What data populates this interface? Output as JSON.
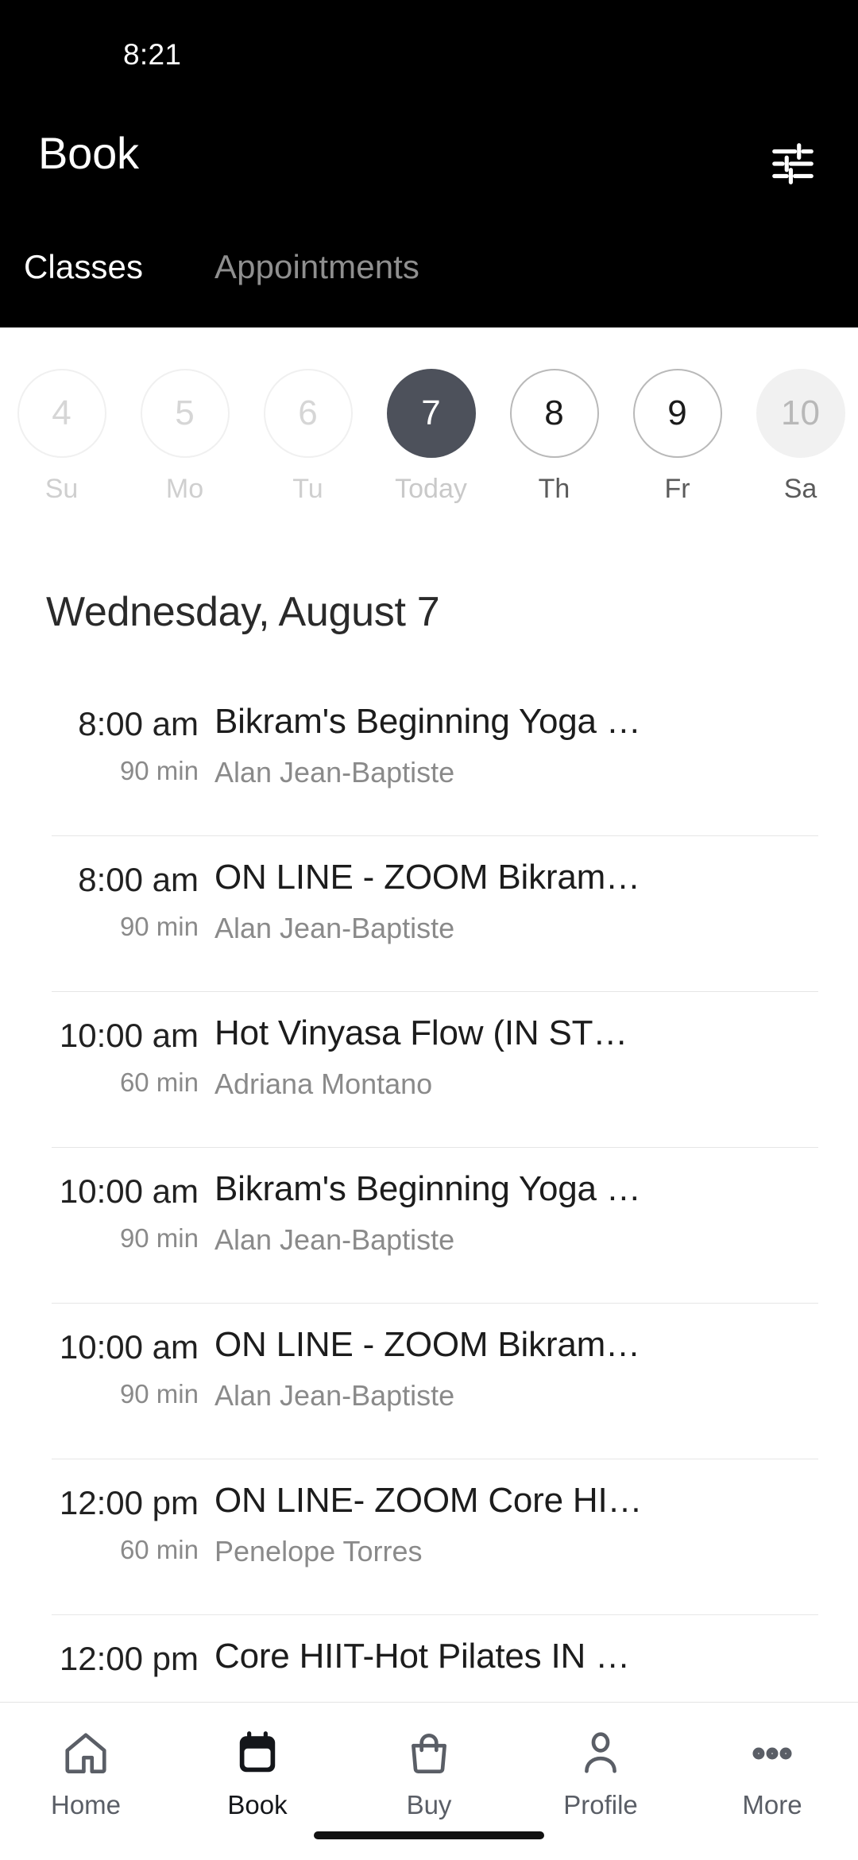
{
  "status_bar": {
    "time": "8:21"
  },
  "header": {
    "title": "Book",
    "filter_icon": "tune-sliders-icon",
    "background_color": "#000000",
    "tabs": [
      {
        "label": "Classes",
        "selected": true
      },
      {
        "label": "Appointments",
        "selected": false
      }
    ]
  },
  "date_strip": {
    "days": [
      {
        "num": "4",
        "label": "Su",
        "state": "disabled"
      },
      {
        "num": "5",
        "label": "Mo",
        "state": "disabled"
      },
      {
        "num": "6",
        "label": "Tu",
        "state": "disabled"
      },
      {
        "num": "7",
        "label": "Today",
        "state": "selected"
      },
      {
        "num": "8",
        "label": "Th",
        "state": "active"
      },
      {
        "num": "9",
        "label": "Fr",
        "state": "active"
      },
      {
        "num": "10",
        "label": "Sa",
        "state": "filled"
      }
    ],
    "selected_color": "#4d515b"
  },
  "day_heading": "Wednesday, August 7",
  "classes": [
    {
      "time": "8:00 am",
      "duration": "90 min",
      "name": "Bikram's Beginning Yoga …",
      "instructor": "Alan Jean-Baptiste"
    },
    {
      "time": "8:00 am",
      "duration": "90 min",
      "name": "ON LINE - ZOOM Bikram…",
      "instructor": "Alan Jean-Baptiste"
    },
    {
      "time": "10:00 am",
      "duration": "60 min",
      "name": "Hot Vinyasa Flow (IN ST…",
      "instructor": "Adriana Montano"
    },
    {
      "time": "10:00 am",
      "duration": "90 min",
      "name": "Bikram's Beginning Yoga …",
      "instructor": "Alan Jean-Baptiste"
    },
    {
      "time": "10:00 am",
      "duration": "90 min",
      "name": "ON LINE - ZOOM Bikram…",
      "instructor": "Alan Jean-Baptiste"
    },
    {
      "time": "12:00 pm",
      "duration": "60 min",
      "name": "ON LINE- ZOOM Core HI…",
      "instructor": "Penelope Torres"
    },
    {
      "time": "12:00 pm",
      "duration": "",
      "name": "Core HIIT-Hot Pilates IN …",
      "instructor": ""
    }
  ],
  "bottom_nav": {
    "items": [
      {
        "label": "Home",
        "icon": "home-icon",
        "active": false
      },
      {
        "label": "Book",
        "icon": "calendar-icon",
        "active": true
      },
      {
        "label": "Buy",
        "icon": "bag-icon",
        "active": false
      },
      {
        "label": "Profile",
        "icon": "person-icon",
        "active": false
      },
      {
        "label": "More",
        "icon": "ellipsis-icon",
        "active": false
      }
    ]
  }
}
